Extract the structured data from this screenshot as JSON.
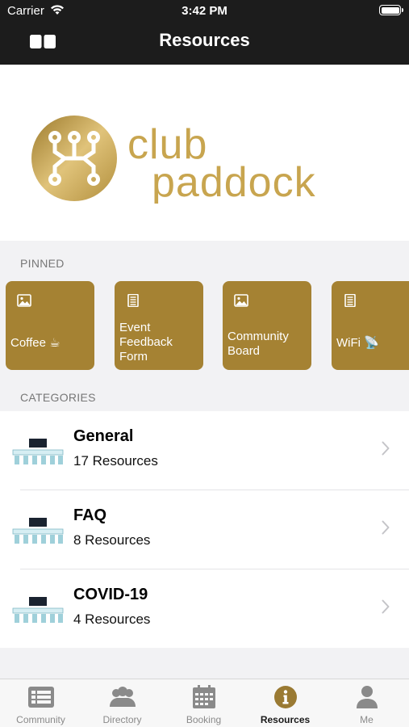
{
  "status_bar": {
    "carrier": "Carrier",
    "time": "3:42 PM"
  },
  "nav": {
    "title": "Resources"
  },
  "logo": {
    "line1": "club",
    "line2": "paddock",
    "color": "#c5a24a"
  },
  "pinned": {
    "header": "PINNED",
    "items": [
      {
        "label": "Coffee ☕",
        "icon": "image-icon"
      },
      {
        "label": "Event Feedback Form",
        "icon": "document-icon"
      },
      {
        "label": "Community Board",
        "icon": "image-icon"
      },
      {
        "label": "WiFi 📡",
        "icon": "document-icon"
      }
    ]
  },
  "categories": {
    "header": "CATEGORIES",
    "items": [
      {
        "name": "General",
        "count": "17 Resources"
      },
      {
        "name": "FAQ",
        "count": "8 Resources"
      },
      {
        "name": "COVID-19",
        "count": "4 Resources"
      }
    ]
  },
  "tabs": [
    {
      "label": "Community",
      "icon": "newsfeed-icon",
      "active": false
    },
    {
      "label": "Directory",
      "icon": "people-icon",
      "active": false
    },
    {
      "label": "Booking",
      "icon": "calendar-icon",
      "active": false
    },
    {
      "label": "Resources",
      "icon": "info-icon",
      "active": true
    },
    {
      "label": "Me",
      "icon": "person-icon",
      "active": false
    }
  ],
  "colors": {
    "accent": "#a58233",
    "nav_bg": "#1c1c1c"
  }
}
